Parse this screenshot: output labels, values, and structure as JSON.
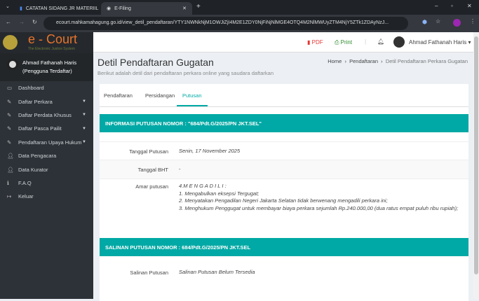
{
  "browser": {
    "tabs": [
      {
        "label": "CATATAN SIDANG JR MATERIIL"
      },
      {
        "label": "E-Filing"
      }
    ],
    "url": "ecourt.mahkamahagung.go.id/view_detil_pendaftaran/YTY1NWNkNjM1OWJiZjI4M2E1ZDY0NjFiNjNlMGE4OTQ4M2NlMWUyZTM4NjY5ZTk1ZDAyNzJ..."
  },
  "logo": {
    "title": "e - Court",
    "subtitle": "The Electronic Justice System"
  },
  "user": {
    "name": "Ahmad Fathanah Haris",
    "role": "(Pengguna Terdaftar)"
  },
  "sidebar": {
    "items": [
      {
        "label": "Dashboard",
        "icon": "laptop-icon"
      },
      {
        "label": "Daftar Perkara",
        "icon": "edit-icon",
        "caret": true
      },
      {
        "label": "Daftar Perdata Khusus",
        "icon": "edit-icon",
        "caret": true
      },
      {
        "label": "Daftar Pasca Pailit",
        "icon": "edit-icon",
        "caret": true
      },
      {
        "label": "Pendaftaran Upaya Hukum",
        "icon": "edit-icon",
        "caret": true
      },
      {
        "label": "Data Pengacara",
        "icon": "user-icon"
      },
      {
        "label": "Data Kurator",
        "icon": "user-icon"
      },
      {
        "label": "F.A.Q",
        "icon": "info-icon"
      },
      {
        "label": "Keluar",
        "icon": "sign-out-icon"
      }
    ]
  },
  "header": {
    "pdf": "PDF",
    "print": "Print",
    "user": "Ahmad Fathanah Haris"
  },
  "page": {
    "title": "Detil Pendaftaran Gugatan",
    "subtitle": "Berikut adalah detil dari pendaftaran perkara online yang saudara daftarkan",
    "breadcrumb": [
      "Home",
      "Pendaftaran",
      "Detil Pendaftaran Perkara Gugatan"
    ]
  },
  "tabs": [
    "Pendaftaran",
    "Persidangan",
    "Putusan"
  ],
  "putusan": {
    "header": "INFORMASI PUTUSAN NOMOR : \"684/Pdt.G/2025/PN JKT.SEL\"",
    "tanggal_label": "Tanggal Putusan",
    "tanggal": "Senin, 17 November 2025",
    "bht_label": "Tanggal BHT",
    "bht": "-",
    "amar_label": "Amar putusan",
    "amar": [
      "4.M E N G A D I L I :",
      "1. Mengabulkan eksepsi Tergugat;",
      "2. Menyatakan Pengadilan Negeri Jakarta Selatan tidak berwenang mengadili perkara ini;",
      "3. Menghukum Penggugat untuk membayar biaya perkara sejumlah Rp.240.000,00 (dua ratus empat puluh ribu rupiah);"
    ]
  },
  "salinan": {
    "header": "SALINAN PUTUSAN NOMOR : 684/Pdt.G/2025/PN JKT.SEL",
    "label": "Salinan Putusan",
    "value": "Salinan Putusan Belum Tersedia"
  },
  "colors": {
    "teal": "#00a9a5",
    "sidebar": "#2d3238",
    "accent": "#e8732a"
  }
}
